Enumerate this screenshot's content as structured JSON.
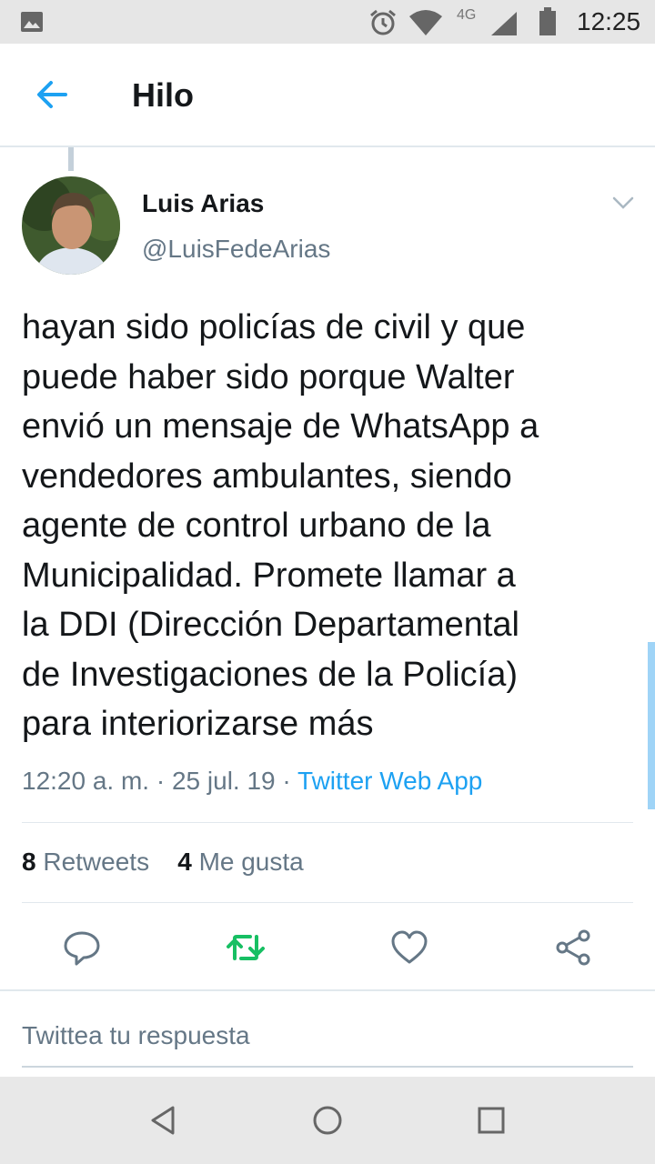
{
  "status_bar": {
    "network": "4G",
    "time": "12:25",
    "icons": [
      "image-icon",
      "alarm-icon",
      "wifi-icon",
      "signal-icon",
      "battery-icon"
    ]
  },
  "app_bar": {
    "title": "Hilo",
    "back_icon": "arrow-left-icon"
  },
  "tweet": {
    "author_name": "Luis Arias",
    "author_handle": "@LuisFedeArias",
    "text_lines": [
      "hayan sido policías de civil y que",
      "puede haber sido porque Walter",
      "envió un mensaje de WhatsApp a",
      "vendedores ambulantes, siendo",
      "agente de control urbano de la",
      "Municipalidad. Promete llamar a",
      "la DDI (Dirección Departamental",
      "de Investigaciones de la Policía)",
      "para interiorizarse más"
    ],
    "time": "12:20 a. m.",
    "separator": "·",
    "date": "25 jul. 19",
    "source": "Twitter Web App",
    "retweets_count": "8",
    "retweets_label": "Retweets",
    "likes_count": "4",
    "likes_label": "Me gusta"
  },
  "actions": [
    "reply-icon",
    "retweet-icon",
    "like-icon",
    "share-icon"
  ],
  "reply_box": {
    "placeholder": "Twittea tu respuesta"
  },
  "colors": {
    "accent": "#1da1f2",
    "retweet": "#17bf63",
    "secondary_text": "#657786"
  }
}
